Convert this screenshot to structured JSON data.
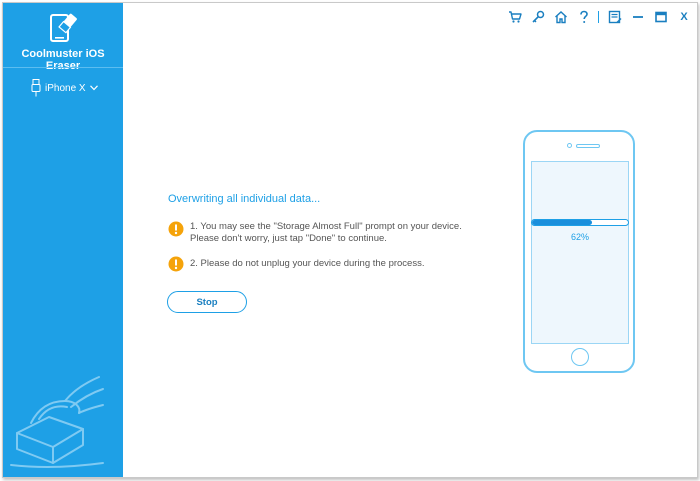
{
  "app": {
    "title": "Coolmuster iOS Eraser"
  },
  "device": {
    "name": "iPhone X"
  },
  "toolbar": {
    "close_label": "X"
  },
  "main": {
    "status": "Overwriting all individual data...",
    "warnings": [
      {
        "line1": "1. You may see the \"Storage Almost Full\" prompt on your device.",
        "line2": "Please don't worry, just tap \"Done\" to continue."
      },
      {
        "line1": "2. Please do not unplug your device during the process.",
        "line2": ""
      }
    ],
    "stop_label": "Stop"
  },
  "progress": {
    "label": "62%",
    "value": 62
  },
  "colors": {
    "sidebar": "#1ea0e6",
    "accent": "#1ea0e6",
    "warning": "#f5a30a"
  }
}
